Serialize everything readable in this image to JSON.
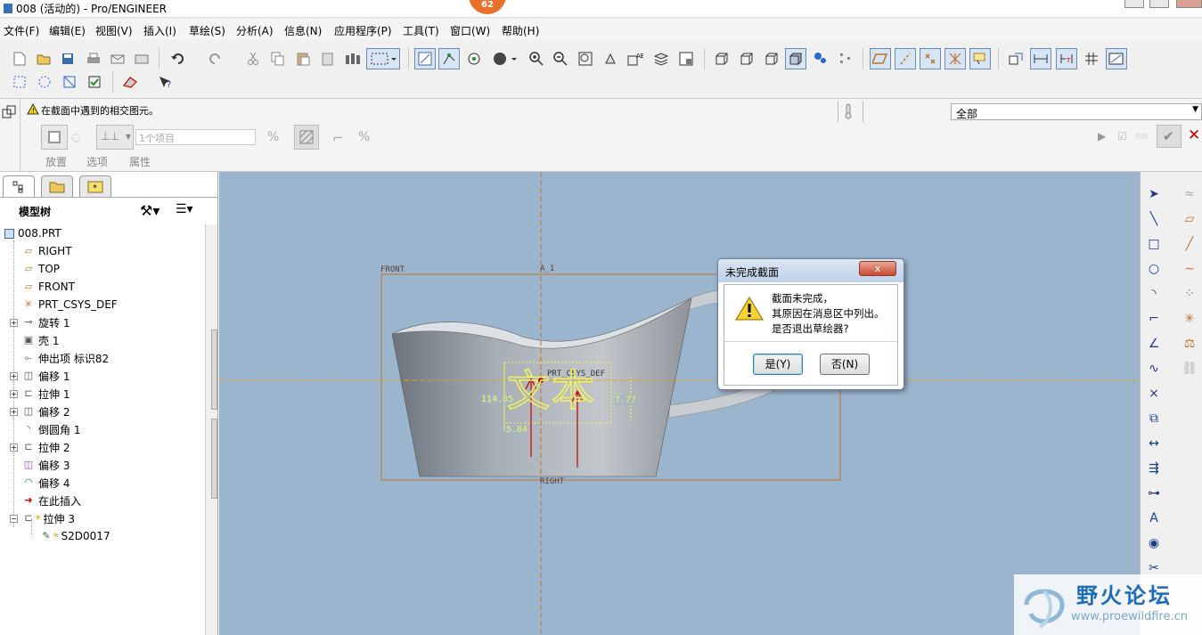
{
  "window": {
    "title": "008 (活动的) - Pro/ENGINEER",
    "notification_badge": "62"
  },
  "menubar": [
    "文件(F)",
    "编辑(E)",
    "视图(V)",
    "插入(I)",
    "草绘(S)",
    "分析(A)",
    "信息(N)",
    "应用程序(P)",
    "工具(T)",
    "窗口(W)",
    "帮助(H)"
  ],
  "dashboard": {
    "message": "在截面中遇到的相交图元。",
    "filter_value": "全部",
    "reference_field": "1个项目",
    "tabs": [
      "放置",
      "选项",
      "属性"
    ]
  },
  "model_tree": {
    "title": "模型树",
    "root": "008.PRT",
    "items": [
      "RIGHT",
      "TOP",
      "FRONT",
      "PRT_CSYS_DEF",
      "旋转 1",
      "壳 1",
      "伸出项 标识82",
      "偏移 1",
      "拉伸 1",
      "偏移 2",
      "倒圆角 1",
      "拉伸 2",
      "偏移 3",
      "偏移 4",
      "在此插入",
      "拉伸 3",
      "S2D0017"
    ]
  },
  "canvas": {
    "plane_front": "FRONT",
    "plane_right": "RIGHT",
    "axis_label": "A_1",
    "csys_label": "PRT_CSYS_DEF",
    "sketch_text": "文本",
    "dim_left": "114.85",
    "dim_bottom": "5.84",
    "dim_right": "7.77"
  },
  "dialog": {
    "title": "未完成截面",
    "close_label": "x",
    "line1": "截面未完成，",
    "line2": "其原因在消息区中列出。",
    "line3": "是否退出草绘器?",
    "yes_label": "是(Y)",
    "no_label": "否(N)"
  },
  "watermark": {
    "title": "野火论坛",
    "url": "www.proewildfire.cn"
  },
  "colors": {
    "canvas_bg": "#9bb5cf",
    "sketch_yellow": "#f2f25a",
    "dim_red": "#c00000",
    "datum_orange": "#c0722a"
  }
}
